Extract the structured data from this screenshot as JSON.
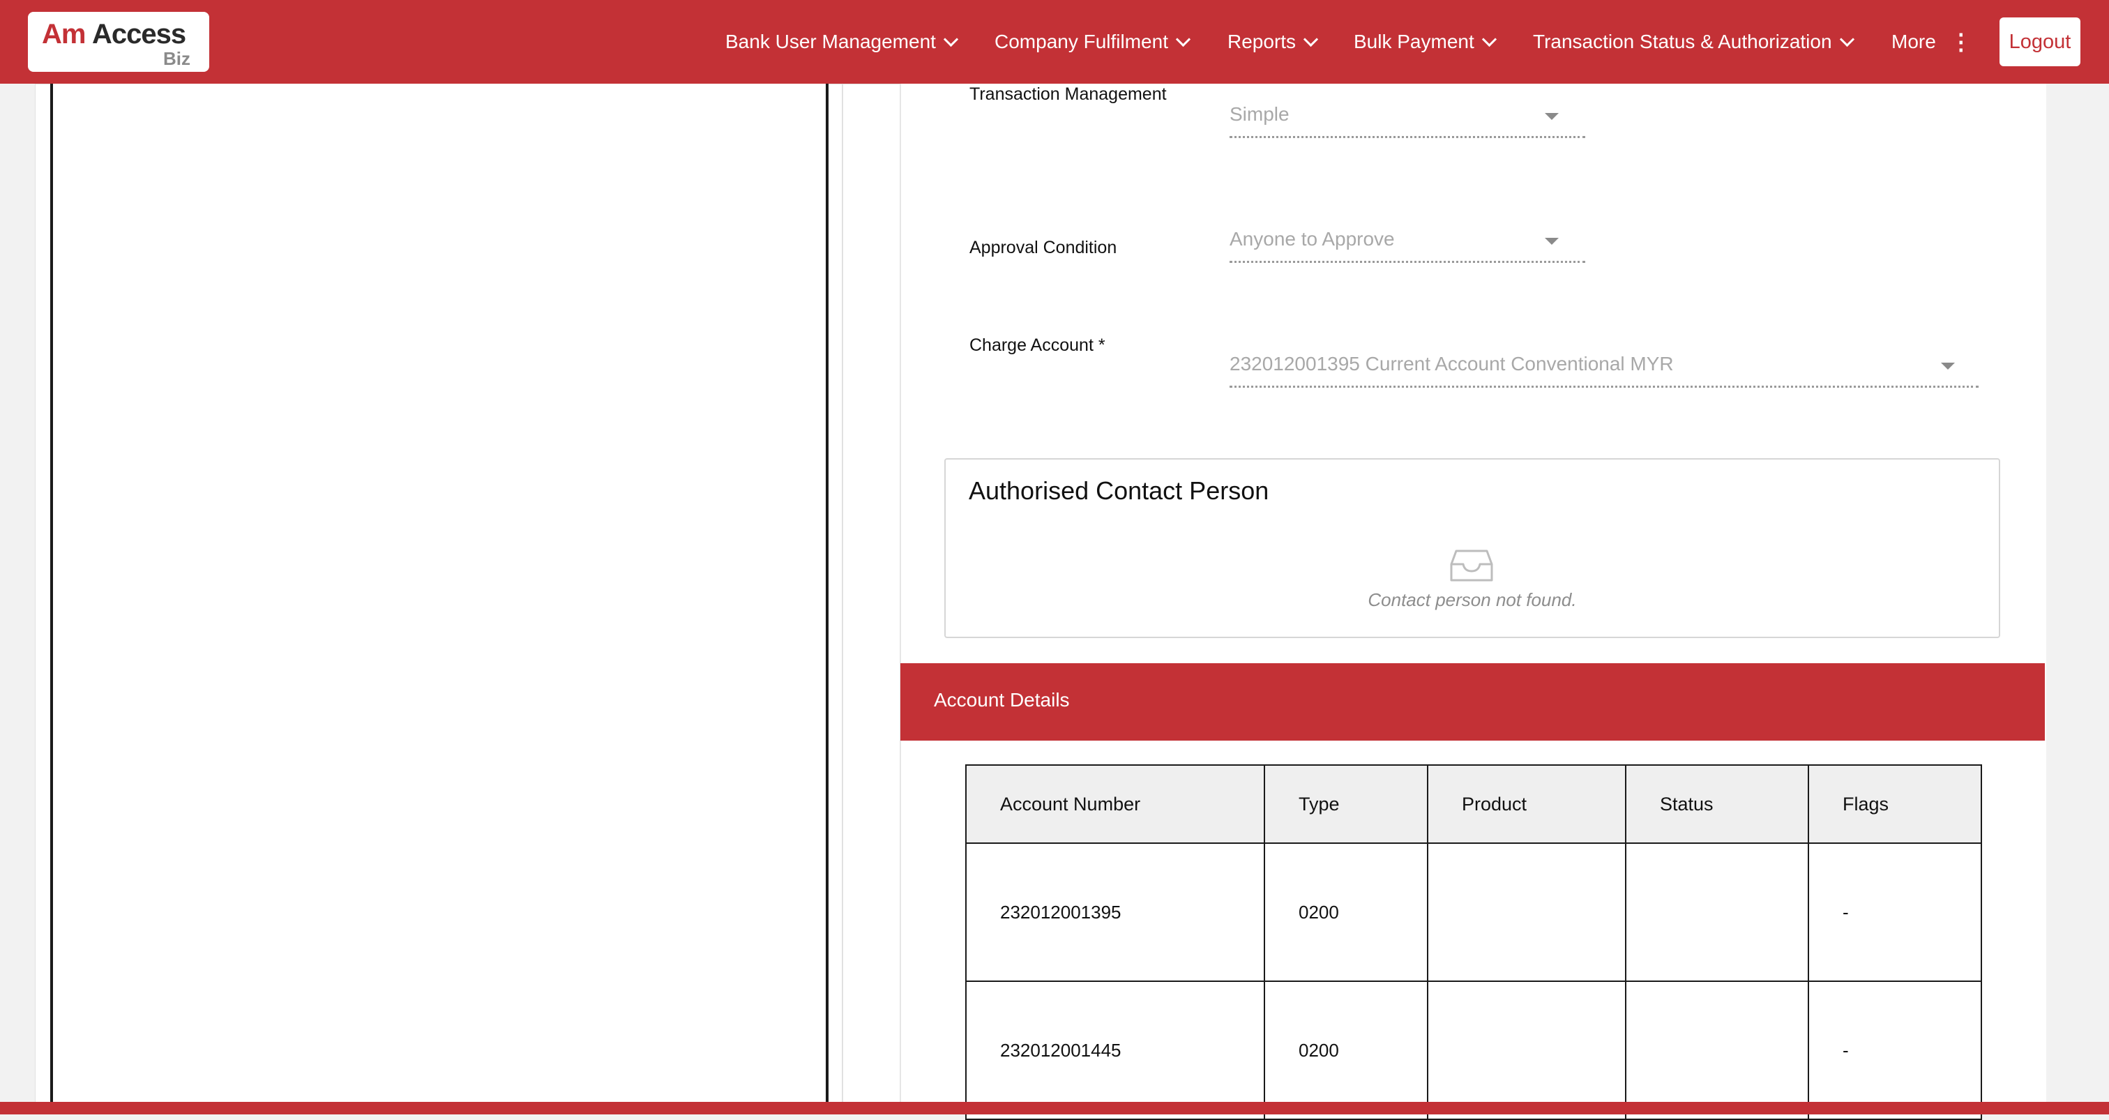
{
  "brand": {
    "logo_am": "Am",
    "logo_access": "Access",
    "logo_biz": "Biz",
    "primary_color": "#c33136"
  },
  "nav": {
    "items": [
      {
        "label": "Bank User Management",
        "icon": "chevron-down-icon"
      },
      {
        "label": "Company Fulfilment",
        "icon": "chevron-down-icon"
      },
      {
        "label": "Reports",
        "icon": "chevron-down-icon"
      },
      {
        "label": "Bulk Payment",
        "icon": "chevron-down-icon"
      },
      {
        "label": "Transaction Status & Authorization",
        "icon": "chevron-down-icon"
      },
      {
        "label": "More",
        "icon": "more-vertical-icon"
      }
    ],
    "logout_label": "Logout"
  },
  "form": {
    "transaction_management": {
      "label": "Transaction Management",
      "value": "Simple"
    },
    "approval_condition": {
      "label": "Approval Condition",
      "value": "Anyone to Approve"
    },
    "charge_account": {
      "label": "Charge Account *",
      "value": "232012001395 Current Account Conventional MYR"
    }
  },
  "contact": {
    "title": "Authorised Contact Person",
    "empty_icon": "inbox-icon",
    "empty_text": "Contact person not found."
  },
  "account_details": {
    "title": "Account Details",
    "columns": [
      "Account Number",
      "Type",
      "Product",
      "Status",
      "Flags"
    ],
    "rows": [
      {
        "account_number": "232012001395",
        "type": "0200",
        "product": "",
        "status": "",
        "flags": "-"
      },
      {
        "account_number": "232012001445",
        "type": "0200",
        "product": "",
        "status": "",
        "flags": "-"
      }
    ]
  }
}
